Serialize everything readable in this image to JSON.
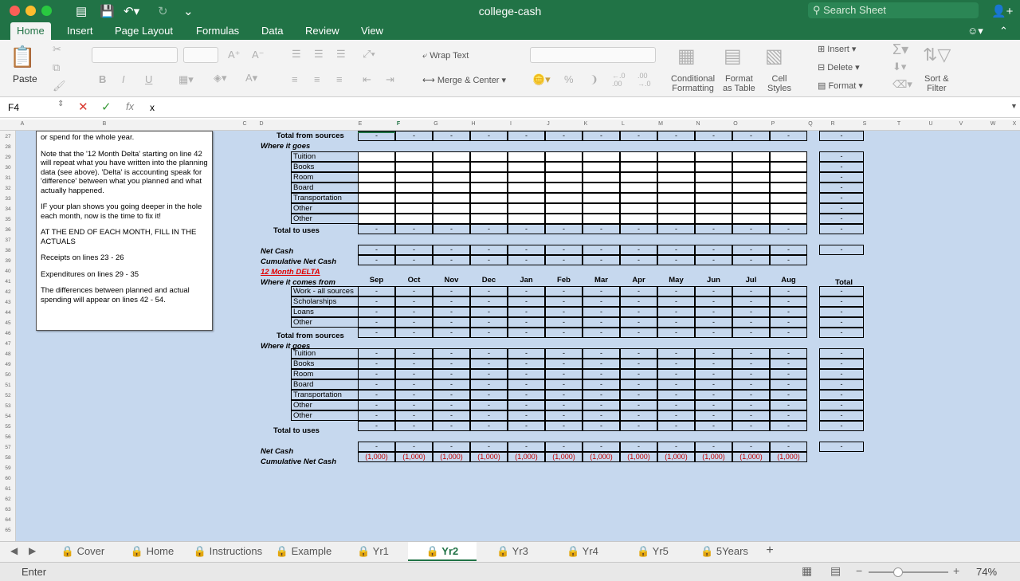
{
  "window": {
    "title": "college-cash",
    "search_placeholder": "Search Sheet"
  },
  "ribbon_tabs": [
    "Home",
    "Insert",
    "Page Layout",
    "Formulas",
    "Data",
    "Review",
    "View"
  ],
  "ribbon": {
    "paste": "Paste",
    "wrap_text": "Wrap Text",
    "merge_center": "Merge & Center",
    "conditional_formatting": [
      "Conditional",
      "Formatting"
    ],
    "format_as_table": [
      "Format",
      "as Table"
    ],
    "cell_styles": [
      "Cell",
      "Styles"
    ],
    "insert": "Insert",
    "delete": "Delete",
    "format": "Format",
    "sort_filter": [
      "Sort &",
      "Filter"
    ],
    "percent": "%"
  },
  "formula_bar": {
    "name_box": "F4",
    "fx": "fx",
    "value": "x"
  },
  "columns": [
    "A",
    "B",
    "C",
    "D",
    "E",
    "F",
    "G",
    "H",
    "I",
    "J",
    "K",
    "L",
    "M",
    "N",
    "O",
    "P",
    "Q",
    "R",
    "S",
    "T",
    "U",
    "V",
    "W",
    "X"
  ],
  "rows": [
    "27",
    "28",
    "29",
    "30",
    "31",
    "32",
    "33",
    "34",
    "35",
    "36",
    "37",
    "38",
    "39",
    "40",
    "41",
    "42",
    "43",
    "44",
    "45",
    "46",
    "47",
    "48",
    "49",
    "50",
    "51",
    "52",
    "53",
    "54",
    "55",
    "56",
    "57",
    "58",
    "59",
    "60",
    "61",
    "62",
    "63",
    "64",
    "65"
  ],
  "instructions": {
    "p0": "or spend for the whole year.",
    "p1": "Note that the '12 Month Delta' starting on line 42 will repeat what you have written into the planning data (see above). 'Delta' is accounting speak for 'difference' between what you planned and what actually happened.",
    "p2": "IF your plan shows you going deeper in the hole each month, now is the time to fix it!",
    "p3": "AT THE END OF EACH MONTH, FILL IN THE ACTUALS",
    "p4": "Receipts on lines 23 - 26",
    "p5": "Expenditures on lines 29 - 35",
    "p6": "The differences between planned and actual spending will appear on lines 42 - 54."
  },
  "plan": {
    "total_from_sources": "Total from sources",
    "where_it_goes": "Where it goes",
    "expense_items": [
      "Tuition",
      "Books",
      "Room",
      "Board",
      "Transportation",
      "Other",
      "Other"
    ],
    "total_to_uses": "Total to uses",
    "net_cash": "Net Cash",
    "cumulative_net_cash": "Cumulative Net Cash",
    "dash": "-"
  },
  "delta": {
    "title": "12 Month DELTA",
    "where_it_comes_from": "Where it comes from",
    "months": [
      "Sep",
      "Oct",
      "Nov",
      "Dec",
      "Jan",
      "Feb",
      "Mar",
      "Apr",
      "May",
      "Jun",
      "Jul",
      "Aug"
    ],
    "total_header": "Total",
    "source_items": [
      "Work - all sources",
      "Scholarships",
      "Loans",
      "Other"
    ],
    "total_from_sources": "Total from sources",
    "where_it_goes": "Where it goes",
    "expense_items": [
      "Tuition",
      "Books",
      "Room",
      "Board",
      "Transportation",
      "Other",
      "Other"
    ],
    "total_to_uses": "Total to uses",
    "net_cash": "Net Cash",
    "cumulative_net_cash": "Cumulative Net Cash",
    "cumulative_values": [
      "(1,000)",
      "(1,000)",
      "(1,000)",
      "(1,000)",
      "(1,000)",
      "(1,000)",
      "(1,000)",
      "(1,000)",
      "(1,000)",
      "(1,000)",
      "(1,000)",
      "(1,000)"
    ]
  },
  "sheet_tabs": [
    "Cover",
    "Home",
    "Instructions",
    "Example",
    "Yr1",
    "Yr2",
    "Yr3",
    "Yr4",
    "Yr5",
    "5Years"
  ],
  "active_sheet": "Yr2",
  "status": {
    "mode": "Enter",
    "zoom": "74%"
  },
  "colors": {
    "excel_green": "#217346",
    "grid_bg": "#c6d8ee",
    "negative": "#c00000",
    "delta_title": "#e00000"
  }
}
